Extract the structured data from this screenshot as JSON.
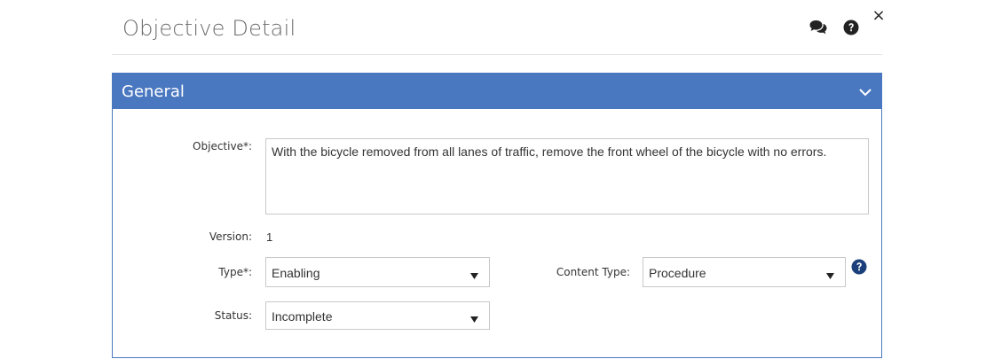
{
  "dialog": {
    "title": "Objective Detail",
    "icons": {
      "comments": "comments-icon",
      "help": "question-circle-icon",
      "close": "×"
    }
  },
  "panel": {
    "title": "General",
    "collapse_icon": "chevron-down-icon"
  },
  "form": {
    "objective": {
      "label": "Objective*:",
      "value": "With the bicycle removed from all lanes of traffic, remove the front wheel of the bicycle with no errors."
    },
    "version": {
      "label": "Version:",
      "value": "1"
    },
    "type": {
      "label": "Type*:",
      "value": "Enabling"
    },
    "content_type": {
      "label": "Content Type:",
      "value": "Procedure"
    },
    "status": {
      "label": "Status:",
      "value": "Incomplete"
    }
  },
  "colors": {
    "accent": "#4a78c0",
    "border": "#c8c8c8",
    "title_text": "#6b6b6b",
    "icon_dark": "#222222"
  }
}
